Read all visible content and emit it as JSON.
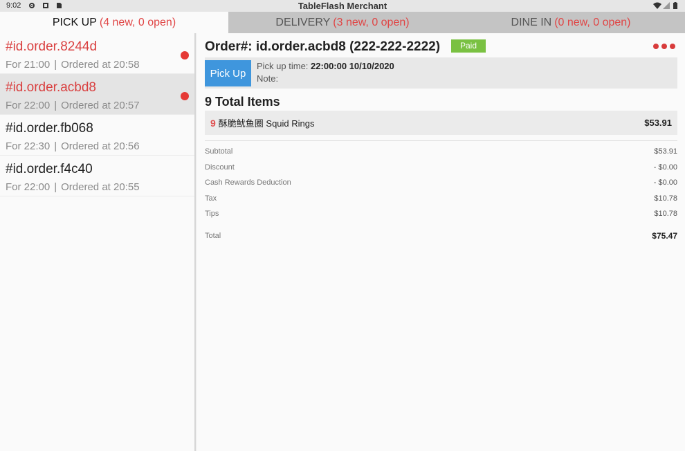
{
  "status_bar": {
    "time": "9:02",
    "app_title": "TableFlash Merchant"
  },
  "tabs": [
    {
      "label": "PICK UP",
      "count": "(4 new, 0 open)",
      "active": true
    },
    {
      "label": "DELIVERY",
      "count": "(3 new, 0 open)",
      "active": false
    },
    {
      "label": "DINE IN",
      "count": "(0 new, 0 open)",
      "active": false
    }
  ],
  "orders": [
    {
      "id": "#id.order.8244d",
      "for": "For 21:00",
      "ordered": "Ordered at 20:58",
      "highlight": true,
      "new": true,
      "selected": false
    },
    {
      "id": "#id.order.acbd8",
      "for": "For 22:00",
      "ordered": "Ordered at 20:57",
      "highlight": true,
      "new": true,
      "selected": true
    },
    {
      "id": "#id.order.fb068",
      "for": "For 22:30",
      "ordered": "Ordered at 20:56",
      "highlight": false,
      "new": false,
      "selected": false
    },
    {
      "id": "#id.order.f4c40",
      "for": "For 22:00",
      "ordered": "Ordered at 20:55",
      "highlight": false,
      "new": false,
      "selected": false
    }
  ],
  "detail": {
    "header": "Order#: id.order.acbd8 (222-222-2222)",
    "paid_label": "Paid",
    "pickup_button": "Pick Up",
    "pickup_time_label": "Pick up time:",
    "pickup_time_value": "22:00:00 10/10/2020",
    "note_label": "Note:",
    "total_items": "9 Total Items",
    "items": [
      {
        "qty": "9",
        "name": "酥脆鱿鱼圈 Squid Rings",
        "price": "$53.91"
      }
    ],
    "summary": {
      "subtotal_label": "Subtotal",
      "subtotal": "$53.91",
      "discount_label": "Discount",
      "discount": "- $0.00",
      "cash_rewards_label": "Cash Rewards Deduction",
      "cash_rewards": "- $0.00",
      "tax_label": "Tax",
      "tax": "$10.78",
      "tips_label": "Tips",
      "tips": "$10.78",
      "total_label": "Total",
      "total": "$75.47"
    }
  },
  "colors": {
    "accent_red": "#d94040",
    "paid_green": "#7ac142",
    "pickup_blue": "#3f96dd",
    "scan_orange": "#f5a623"
  }
}
